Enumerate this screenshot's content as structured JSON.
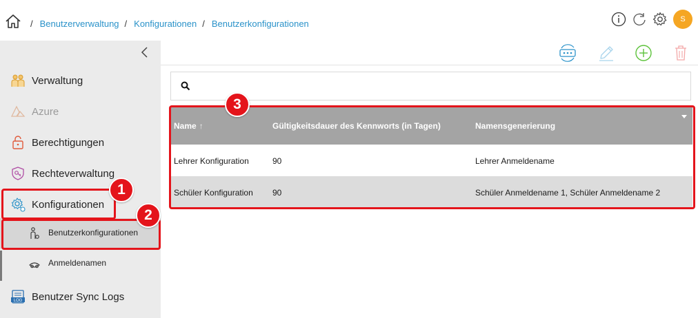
{
  "breadcrumb": {
    "items": [
      {
        "label": "Benutzerverwaltung"
      },
      {
        "label": "Konfigurationen"
      },
      {
        "label": "Benutzerkonfigurationen"
      }
    ],
    "separator": "/"
  },
  "header": {
    "avatar_initial": "S",
    "avatar_color": "#f5a623"
  },
  "sidebar": {
    "items": [
      {
        "label": "Verwaltung",
        "icon": "users-icon"
      },
      {
        "label": "Azure",
        "icon": "azure-icon",
        "disabled": true
      },
      {
        "label": "Berechtigungen",
        "icon": "lock-icon"
      },
      {
        "label": "Rechteverwaltung",
        "icon": "key-icon"
      },
      {
        "label": "Konfigurationen",
        "icon": "gear-users-icon"
      }
    ],
    "subitems": [
      {
        "label": "Benutzerkonfigurationen",
        "icon": "user-config-icon",
        "active": true
      },
      {
        "label": "Anmeldenamen",
        "icon": "login-name-icon"
      }
    ],
    "sync_logs": {
      "label": "Benutzer Sync Logs",
      "icon": "log-icon"
    }
  },
  "toolbar": {
    "buttons": [
      {
        "name": "password-refresh-button",
        "icon": "password-refresh-icon"
      },
      {
        "name": "edit-button",
        "icon": "pencil-icon",
        "disabled": true
      },
      {
        "name": "add-button",
        "icon": "plus-circle-icon"
      },
      {
        "name": "delete-button",
        "icon": "trash-icon",
        "disabled": true
      }
    ]
  },
  "search": {
    "value": "",
    "placeholder": ""
  },
  "table": {
    "columns": [
      "Name",
      "Gültigkeitsdauer des Kennworts (in Tagen)",
      "Namensgenerierung"
    ],
    "sort_indicator": "↑",
    "rows": [
      [
        "Lehrer Konfiguration",
        "90",
        "Lehrer Anmeldename"
      ],
      [
        "Schüler Konfiguration",
        "90",
        "Schüler Anmeldename 1, Schüler Anmeldename 2"
      ]
    ]
  },
  "annotations": {
    "badges": [
      "1",
      "2",
      "3"
    ],
    "color": "#e4141b"
  }
}
